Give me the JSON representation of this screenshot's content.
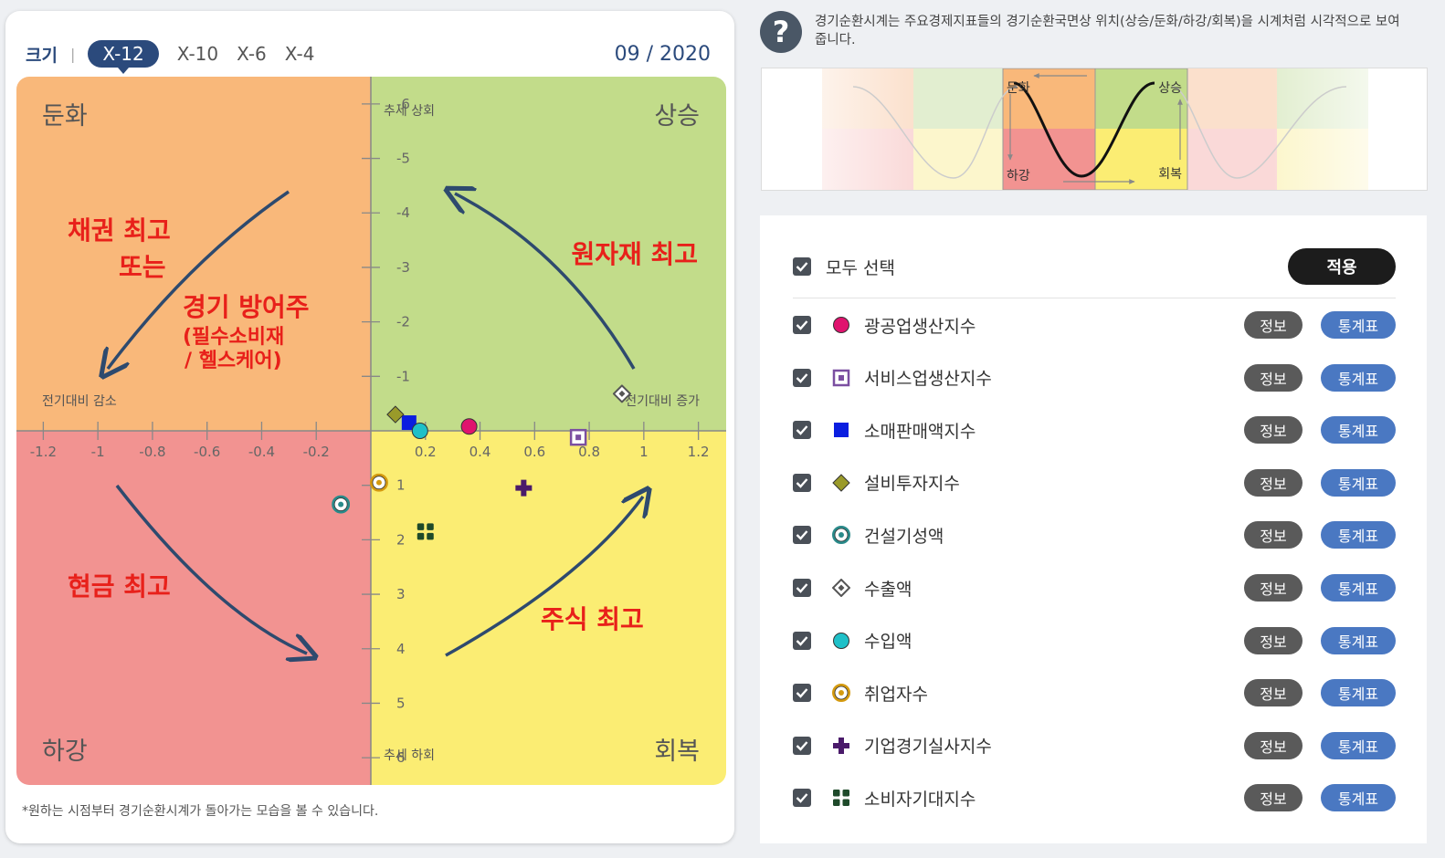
{
  "size_bar": {
    "label": "크기",
    "options": [
      "X-12",
      "X-10",
      "X-6",
      "X-4"
    ],
    "selected": "X-12"
  },
  "date": "09 / 2020",
  "quadrants": {
    "slowdown": "둔화",
    "expansion": "상승",
    "recession": "하강",
    "recovery": "회복"
  },
  "axis_labels": {
    "trend_up": "추세 상회",
    "trend_down": "추세 하회",
    "decrease": "전기대비 감소",
    "increase": "전기대비 증가"
  },
  "annotations": {
    "bonds1": "채권 최고",
    "bonds2": "또는",
    "defensive": "경기 방어주",
    "defensive_sub1": "(필수소비재",
    "defensive_sub2": "/ 헬스케어)",
    "commodities": "원자재 최고",
    "cash": "현금 최고",
    "stocks": "주식 최고"
  },
  "footnote": "*원하는 시점부터 경기순환시계가 돌아가는 모습을 볼 수 있습니다.",
  "help_text": "경기순환시계는 주요경제지표들의 경기순환국면상 위치(상승/둔화/하강/회복)을 시계처럼 시각적으로 보여줍니다.",
  "cycle_labels": {
    "slowdown": "둔화",
    "expansion": "상승",
    "recession": "하강",
    "recovery": "회복"
  },
  "select_all": "모두 선택",
  "apply": "적용",
  "info_label": "정보",
  "stats_label": "통계표",
  "colors": {
    "slowdown": "#f9b87a",
    "expansion": "#c2dc8a",
    "recession": "#f29391",
    "recovery": "#fbed73",
    "arrow": "#2e4a6e",
    "annotation": "#e8201a"
  },
  "chart_data": {
    "type": "scatter",
    "x_axis": {
      "ticks": [
        -1.2,
        -1.0,
        -0.8,
        -0.6,
        -0.4,
        -0.2,
        0.2,
        0.4,
        0.6,
        0.8,
        1.0,
        1.2
      ],
      "range": [
        -1.3,
        1.3
      ]
    },
    "y_axis": {
      "ticks": [
        -6,
        -5,
        -4,
        -3,
        -2,
        -1,
        1,
        2,
        3,
        4,
        5,
        6
      ],
      "range": [
        -6.5,
        6.5
      ],
      "inverted": true
    },
    "series": [
      {
        "name": "광공업생산지수",
        "marker": "circle",
        "color": "#e0136e",
        "x": 0.36,
        "y": -0.08
      },
      {
        "name": "서비스업생산지수",
        "marker": "square-in-square",
        "color": "#7b4fa1",
        "x": 0.76,
        "y": 0.12
      },
      {
        "name": "소매판매액지수",
        "marker": "square",
        "color": "#0a1ee0",
        "x": 0.14,
        "y": -0.15
      },
      {
        "name": "설비투자지수",
        "marker": "diamond",
        "color": "#9a9a2a",
        "x": 0.09,
        "y": -0.3
      },
      {
        "name": "건설기성액",
        "marker": "target",
        "color": "#2a8a8a",
        "x": -0.11,
        "y": 1.35
      },
      {
        "name": "수출액",
        "marker": "diamond-in-diamond",
        "color": "#555555",
        "x": 0.92,
        "y": -0.68
      },
      {
        "name": "수입액",
        "marker": "circle",
        "color": "#1fc0c8",
        "x": 0.18,
        "y": 0.0
      },
      {
        "name": "취업자수",
        "marker": "target",
        "color": "#d49a10",
        "x": 0.03,
        "y": 0.95
      },
      {
        "name": "기업경기실사지수",
        "marker": "plus",
        "color": "#4a1a6a",
        "x": 0.56,
        "y": 1.05
      },
      {
        "name": "소비자기대지수",
        "marker": "grid",
        "color": "#1e4a2a",
        "x": 0.2,
        "y": 1.85
      }
    ]
  },
  "indicators": [
    {
      "label": "광공업생산지수",
      "marker": "circle",
      "color": "#e0136e"
    },
    {
      "label": "서비스업생산지수",
      "marker": "square-in-square",
      "color": "#7b4fa1"
    },
    {
      "label": "소매판매액지수",
      "marker": "square",
      "color": "#0a1ee0"
    },
    {
      "label": "설비투자지수",
      "marker": "diamond",
      "color": "#9a9a2a"
    },
    {
      "label": "건설기성액",
      "marker": "target",
      "color": "#2a8a8a"
    },
    {
      "label": "수출액",
      "marker": "diamond-in-diamond",
      "color": "#555555"
    },
    {
      "label": "수입액",
      "marker": "circle",
      "color": "#1fc0c8"
    },
    {
      "label": "취업자수",
      "marker": "target",
      "color": "#d49a10"
    },
    {
      "label": "기업경기실사지수",
      "marker": "plus",
      "color": "#4a1a6a"
    },
    {
      "label": "소비자기대지수",
      "marker": "grid",
      "color": "#1e4a2a"
    }
  ]
}
